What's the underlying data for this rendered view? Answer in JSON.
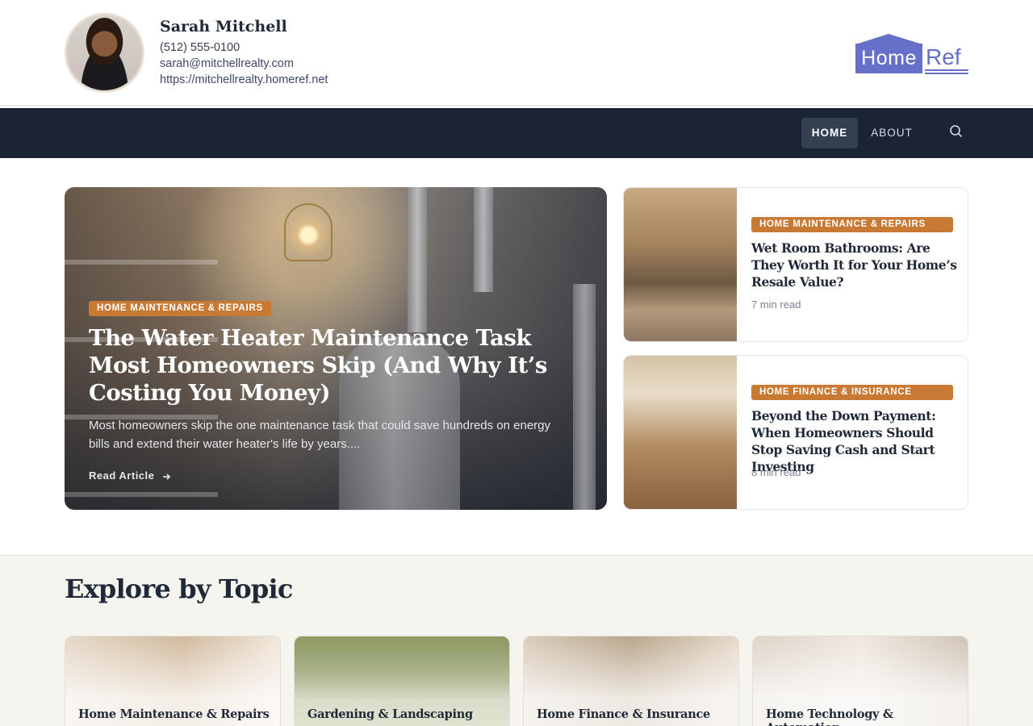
{
  "agent": {
    "name": "Sarah Mitchell",
    "phone": "(512) 555-0100",
    "email": "sarah@mitchellrealty.com",
    "website": "https://mitchellrealty.homeref.net"
  },
  "logo": {
    "part1": "Home",
    "part2": "Ref",
    "color": "#6670c8"
  },
  "nav": {
    "items": [
      {
        "label": "HOME",
        "active": true
      },
      {
        "label": "ABOUT",
        "active": false
      }
    ],
    "search_icon": "search-icon"
  },
  "hero": {
    "category": "HOME MAINTENANCE & REPAIRS",
    "title": "The Water Heater Maintenance Task Most Homeowners Skip (And Why It’s Costing You Money)",
    "excerpt": "Most homeowners skip the one maintenance task that could save hundreds on energy bills and extend their water heater's life by years....",
    "cta": "Read Article",
    "cta_icon": "arrow-right-icon"
  },
  "side_articles": [
    {
      "category": "HOME MAINTENANCE & REPAIRS",
      "title": "Wet Room Bathrooms: Are They Worth It for Your Home’s Resale Value?",
      "read_time": "7 min read"
    },
    {
      "category": "HOME FINANCE & INSURANCE",
      "title": "Beyond the Down Payment: When Homeowners Should Stop Saving Cash and Start Investing",
      "read_time": "8 min read"
    }
  ],
  "explore": {
    "title": "Explore by Topic",
    "topics": [
      {
        "label": "Home Maintenance & Repairs"
      },
      {
        "label": "Gardening & Landscaping"
      },
      {
        "label": "Home Finance & Insurance"
      },
      {
        "label": "Home Technology & Automation"
      }
    ]
  },
  "colors": {
    "nav_bg": "#1b2436",
    "badge": "#c87a34",
    "explore_bg": "#f6f4ef"
  }
}
